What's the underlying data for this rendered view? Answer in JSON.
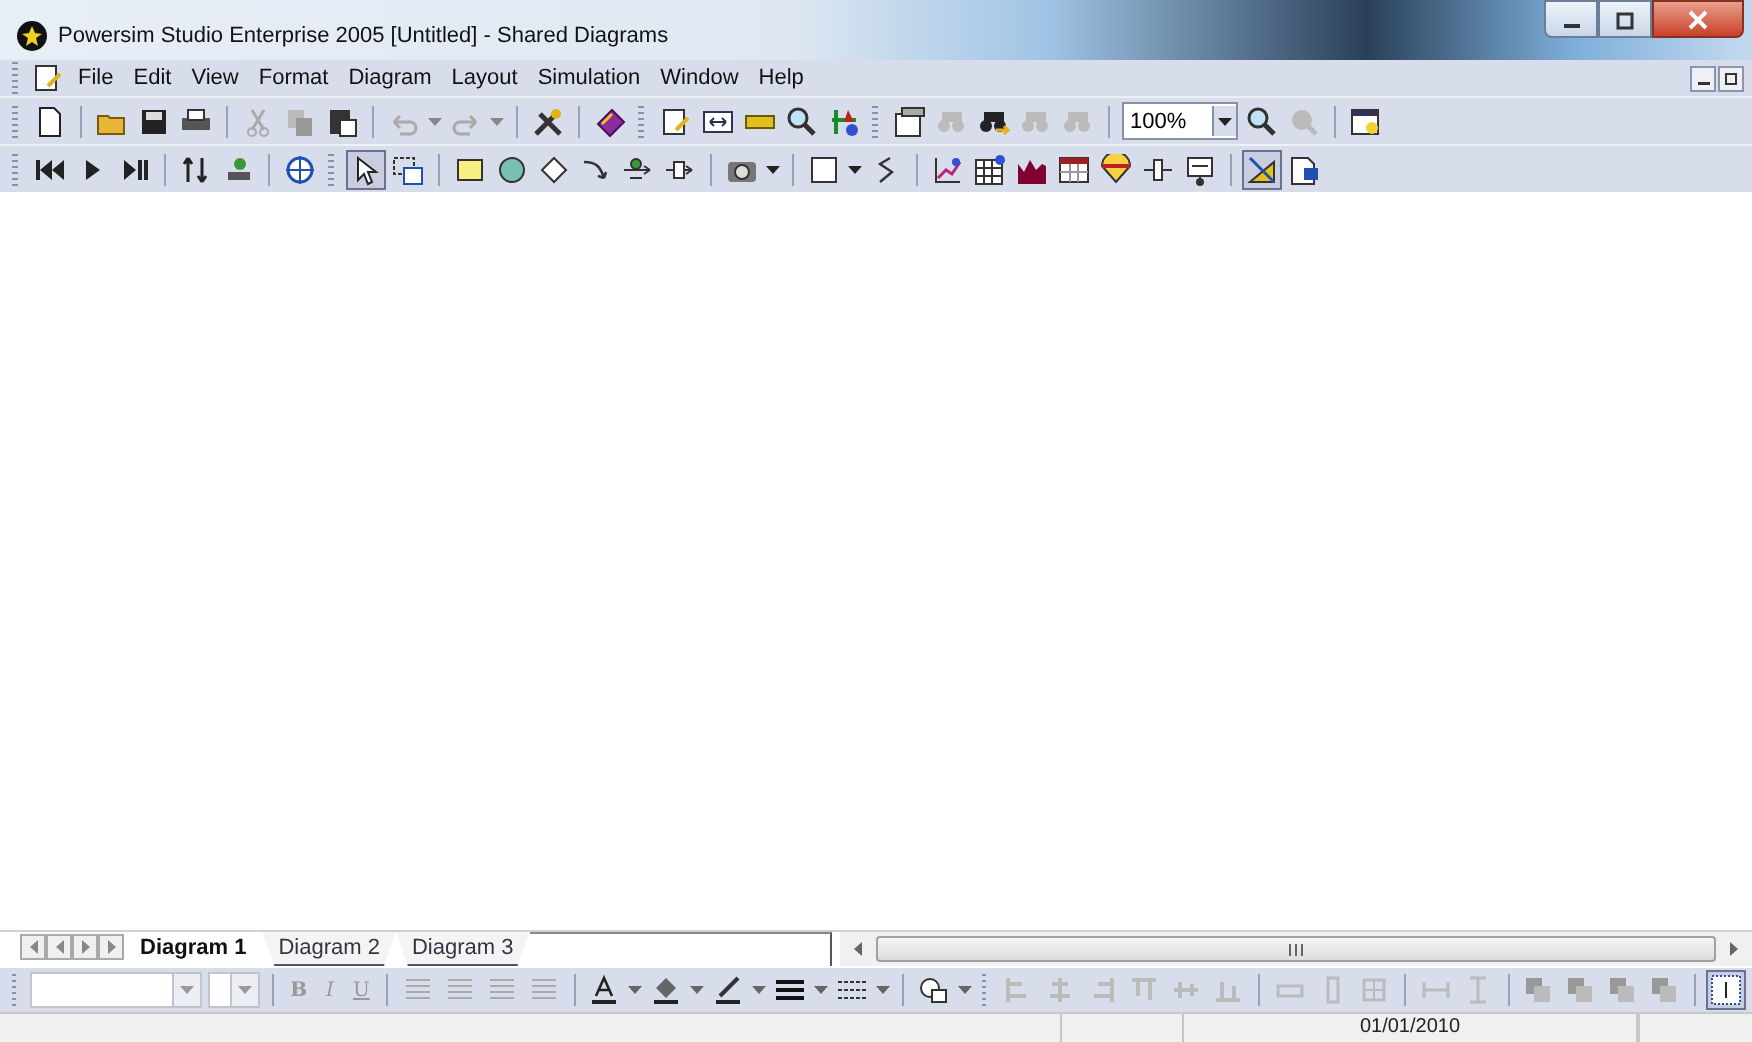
{
  "window": {
    "title": "Powersim Studio Enterprise 2005 [Untitled] - Shared Diagrams"
  },
  "menu": [
    {
      "label": "File"
    },
    {
      "label": "Edit"
    },
    {
      "label": "View"
    },
    {
      "label": "Format"
    },
    {
      "label": "Diagram"
    },
    {
      "label": "Layout"
    },
    {
      "label": "Simulation"
    },
    {
      "label": "Window"
    },
    {
      "label": "Help"
    }
  ],
  "zoom_field": {
    "value": "100%"
  },
  "format_toolbar": {
    "bold": "B",
    "italic": "I",
    "underline": "U"
  },
  "tabs": [
    {
      "label": "Diagram 1",
      "selected": true
    },
    {
      "label": "Diagram 2",
      "selected": false
    },
    {
      "label": "Diagram 3",
      "selected": false
    }
  ],
  "status_bar": {
    "date": "01/01/2010"
  }
}
